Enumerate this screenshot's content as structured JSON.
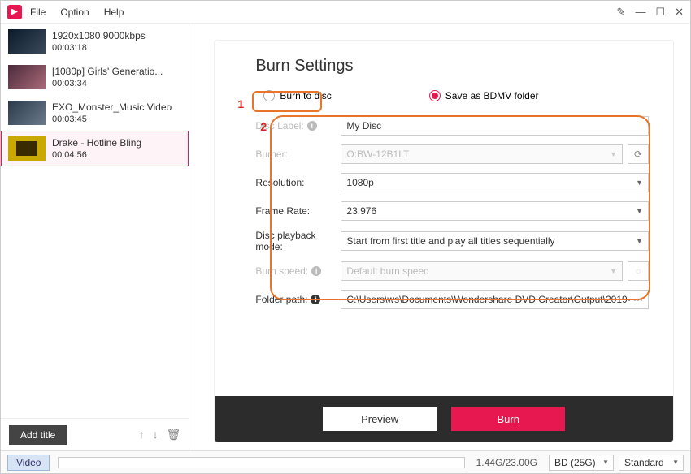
{
  "menu": {
    "file": "File",
    "option": "Option",
    "help": "Help"
  },
  "sidebar": {
    "items": [
      {
        "title": "1920x1080 9000kbps",
        "time": "00:03:18"
      },
      {
        "title": "[1080p] Girls' Generatio...",
        "time": "00:03:34"
      },
      {
        "title": "EXO_Monster_Music Video",
        "time": "00:03:45"
      },
      {
        "title": "Drake - Hotline Bling",
        "time": "00:04:56"
      }
    ],
    "add_title": "Add title"
  },
  "panel": {
    "title": "Burn Settings",
    "radios": {
      "burn_to_disc": "Burn to disc",
      "save_bdmv": "Save as BDMV folder"
    },
    "labels": {
      "disc_label": "Disc Label:",
      "burner": "Burner:",
      "resolution": "Resolution:",
      "frame_rate": "Frame Rate:",
      "playback": "Disc playback mode:",
      "burn_speed": "Burn speed:",
      "folder_path": "Folder path:"
    },
    "values": {
      "disc_label": "My Disc",
      "burner": "O:BW-12B1LT",
      "resolution": "1080p",
      "frame_rate": "23.976",
      "playback": "Start from first title and play all titles sequentially",
      "burn_speed": "Default burn speed",
      "folder_path": "C:\\Users\\ws\\Documents\\Wondershare DVD Creator\\Output\\2019-  ···"
    },
    "buttons": {
      "preview": "Preview",
      "burn": "Burn"
    }
  },
  "annotations": {
    "n1": "1",
    "n2": "2"
  },
  "status": {
    "label": "Video",
    "size": "1.44G/23.00G",
    "disc": "BD (25G)",
    "quality": "Standard"
  }
}
